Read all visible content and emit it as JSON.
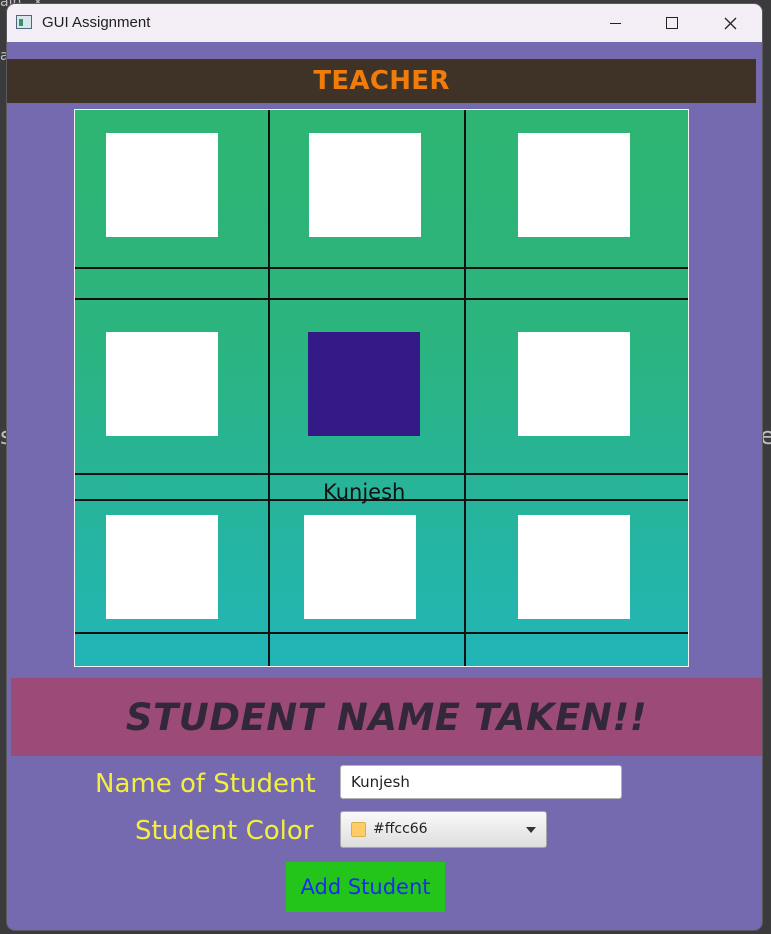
{
  "window": {
    "title": "GUI Assignment",
    "controls": {
      "minimize": "minimize",
      "maximize": "maximize",
      "close": "close"
    }
  },
  "background": {
    "partial_text_top": "ain",
    "partial_x": "×",
    "partial_left": "a",
    "partial_s": "s",
    "partial_e": "e"
  },
  "header": {
    "title": "TEACHER",
    "color": "#f07c0c",
    "background": "#3f3327"
  },
  "grid": {
    "cells": [
      {
        "row": 1,
        "col": 1,
        "selected": false
      },
      {
        "row": 1,
        "col": 2,
        "selected": false
      },
      {
        "row": 1,
        "col": 3,
        "selected": false
      },
      {
        "row": 2,
        "col": 1,
        "selected": false
      },
      {
        "row": 2,
        "col": 2,
        "selected": true,
        "color": "#341a86"
      },
      {
        "row": 2,
        "col": 3,
        "selected": false
      },
      {
        "row": 3,
        "col": 1,
        "selected": false
      },
      {
        "row": 3,
        "col": 2,
        "selected": false
      },
      {
        "row": 3,
        "col": 3,
        "selected": false
      }
    ],
    "seat_label": "Kunjesh"
  },
  "banner": {
    "message": "STUDENT NAME TAKEN!!",
    "background": "#9c4b78"
  },
  "form": {
    "name_label": "Name of Student",
    "name_value": "Kunjesh",
    "color_label": "Student Color",
    "color_value": "#ffcc66",
    "color_swatch": "#ffcc66",
    "submit_label": "Add Student"
  },
  "colors": {
    "window_bg": "#756aaf",
    "label_color": "#f4ef3e",
    "button_bg": "#24c51a",
    "button_text": "#1a2cf0"
  }
}
